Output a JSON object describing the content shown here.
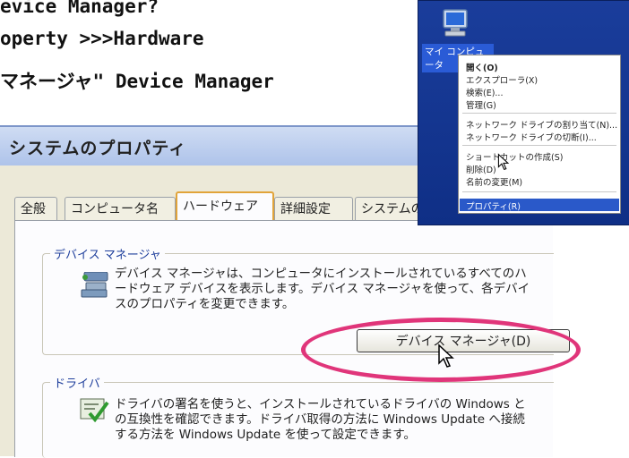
{
  "headings": [
    "evice Manager?",
    "operty >>>Hardware",
    "マネージャ\"  Device Manager"
  ],
  "window": {
    "title": "システムのプロパティ",
    "tabs": [
      "全般",
      "コンピュータ名",
      "ハードウェア",
      "詳細設定",
      "システムの復"
    ],
    "active_tab": "ハードウェア"
  },
  "device_manager": {
    "group_label": "デバイス マネージャ",
    "description": "デバイス マネージャは、コンピュータにインストールされているすべてのハードウェア デバイスを表示します。デバイス マネージャを使って、各デバイスのプロパティを変更できます。",
    "button_label": "デバイス マネージャ(D)",
    "icon": "device-manager-icon"
  },
  "drivers": {
    "group_label": "ドライバ",
    "description": "ドライバの署名を使うと、インストールされているドライバの Windows との互換性を確認できます。ドライバ取得の方法に Windows Update へ接続する方法を Windows Update を使って設定できます。",
    "icon": "driver-signing-icon"
  },
  "context_menu": {
    "desktop_label": "マイ コンピュータ",
    "items": [
      "開く(O)",
      "エクスプローラ(X)",
      "検索(E)...",
      "管理(G)",
      "ネットワーク ドライブの割り当て(N)...",
      "ネットワーク ドライブの切断(I)...",
      "ショートカットの作成(S)",
      "削除(D)",
      "名前の変更(M)",
      "プロパティ(R)"
    ],
    "highlighted": "プロパティ(R)"
  },
  "colors": {
    "highlight_circle": "#e0357a",
    "desktop_blue": "#1a3d9b",
    "window_bg": "#ece9d8"
  }
}
